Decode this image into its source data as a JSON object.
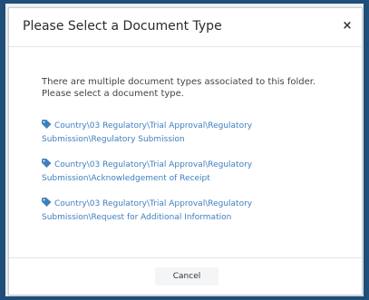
{
  "dialog": {
    "title": "Please Select a Document Type",
    "close_label": "×",
    "intro": "There are multiple document types associated to this folder. Please select a document type.",
    "options": [
      {
        "icon": "tag-icon",
        "label": "Country\\03 Regulatory\\Trial Approval\\Regulatory Submission\\Regulatory Submission"
      },
      {
        "icon": "tag-icon",
        "label": "Country\\03 Regulatory\\Trial Approval\\Regulatory Submission\\Acknowledgement of Receipt"
      },
      {
        "icon": "tag-icon",
        "label": "Country\\03 Regulatory\\Trial Approval\\Regulatory Submission\\Request for Additional Information"
      }
    ],
    "cancel_label": "Cancel"
  },
  "colors": {
    "link": "#3f7fbf",
    "frame": "#1f4e79"
  }
}
